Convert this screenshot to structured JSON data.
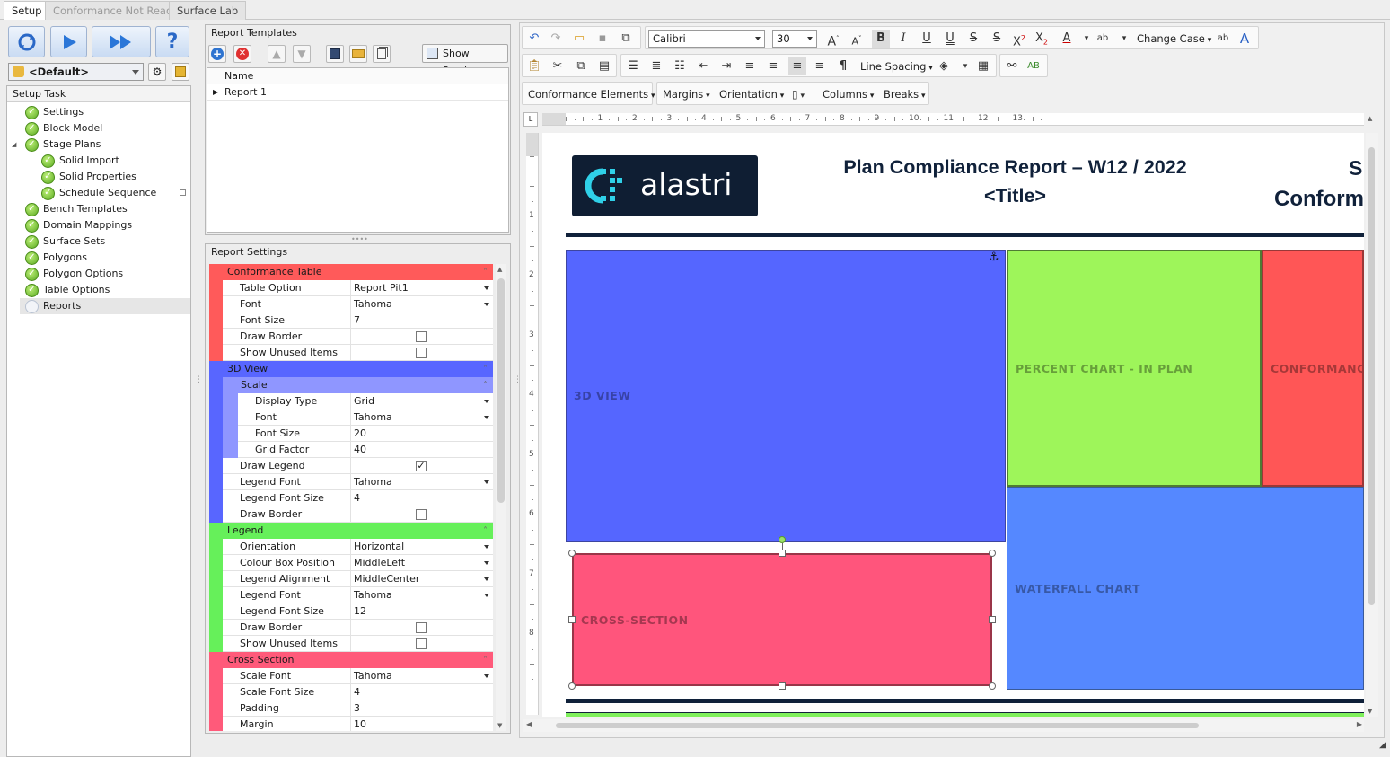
{
  "top_tabs": [
    "Setup",
    "Conformance Not Ready",
    "Surface Lab"
  ],
  "setup": {
    "profile": "<Default>",
    "task_header": "Setup Task",
    "tasks": [
      {
        "label": "Settings",
        "done": true,
        "level": 0
      },
      {
        "label": "Block Model",
        "done": true,
        "level": 0
      },
      {
        "label": "Stage Plans",
        "done": true,
        "level": 0
      },
      {
        "label": "Solid Import",
        "done": true,
        "level": 1
      },
      {
        "label": "Solid Properties",
        "done": true,
        "level": 1
      },
      {
        "label": "Schedule Sequence",
        "done": true,
        "level": 1
      },
      {
        "label": "Bench Templates",
        "done": true,
        "level": 0
      },
      {
        "label": "Domain Mappings",
        "done": true,
        "level": 0
      },
      {
        "label": "Surface Sets",
        "done": true,
        "level": 0
      },
      {
        "label": "Polygons",
        "done": true,
        "level": 0
      },
      {
        "label": "Polygon Options",
        "done": true,
        "level": 0
      },
      {
        "label": "Table Options",
        "done": true,
        "level": 0
      },
      {
        "label": "Reports",
        "done": false,
        "level": 0
      }
    ]
  },
  "report_templates": {
    "title": "Report Templates",
    "show_preview": "Show Preview",
    "column": "Name",
    "rows": [
      "Report 1"
    ]
  },
  "report_settings": {
    "title": "Report Settings",
    "sections": {
      "conformance": {
        "title": "Conformance Table",
        "color": "#ff5a5a",
        "rows": [
          {
            "label": "Table Option",
            "value": "Report Pit1",
            "kind": "dropdown"
          },
          {
            "label": "Font",
            "value": "Tahoma",
            "kind": "dropdown"
          },
          {
            "label": "Font Size",
            "value": "7",
            "kind": "text"
          },
          {
            "label": "Draw Border",
            "value": "",
            "kind": "check",
            "checked": false
          },
          {
            "label": "Show Unused Items",
            "value": "",
            "kind": "check",
            "checked": false
          }
        ]
      },
      "view3d": {
        "title": "3D View",
        "color": "#5866ff",
        "scale_title": "Scale",
        "scale_rows": [
          {
            "label": "Display Type",
            "value": "Grid",
            "kind": "dropdown"
          },
          {
            "label": "Font",
            "value": "Tahoma",
            "kind": "dropdown"
          },
          {
            "label": "Font Size",
            "value": "20",
            "kind": "text"
          },
          {
            "label": "Grid Factor",
            "value": "40",
            "kind": "text"
          }
        ],
        "rows": [
          {
            "label": "Draw Legend",
            "value": "",
            "kind": "check",
            "checked": true
          },
          {
            "label": "Legend Font",
            "value": "Tahoma",
            "kind": "dropdown"
          },
          {
            "label": "Legend Font Size",
            "value": "4",
            "kind": "text"
          },
          {
            "label": "Draw Border",
            "value": "",
            "kind": "check",
            "checked": false
          }
        ]
      },
      "legend": {
        "title": "Legend",
        "color": "#66f05a",
        "rows": [
          {
            "label": "Orientation",
            "value": "Horizontal",
            "kind": "dropdown"
          },
          {
            "label": "Colour Box Position",
            "value": "MiddleLeft",
            "kind": "dropdown"
          },
          {
            "label": "Legend Alignment",
            "value": "MiddleCenter",
            "kind": "dropdown"
          },
          {
            "label": "Legend Font",
            "value": "Tahoma",
            "kind": "dropdown"
          },
          {
            "label": "Legend Font Size",
            "value": "12",
            "kind": "text"
          },
          {
            "label": "Draw Border",
            "value": "",
            "kind": "check",
            "checked": false
          },
          {
            "label": "Show Unused Items",
            "value": "",
            "kind": "check",
            "checked": false
          }
        ]
      },
      "cross": {
        "title": "Cross Section",
        "color": "#ff5a7a",
        "rows": [
          {
            "label": "Scale Font",
            "value": "Tahoma",
            "kind": "dropdown"
          },
          {
            "label": "Scale Font Size",
            "value": "4",
            "kind": "text"
          },
          {
            "label": "Padding",
            "value": "3",
            "kind": "text"
          },
          {
            "label": "Margin",
            "value": "10",
            "kind": "text"
          }
        ]
      }
    }
  },
  "editor": {
    "font_name": "Calibri",
    "font_size": "30",
    "change_case": "Change Case",
    "line_spacing": "Line Spacing",
    "menus": [
      "Conformance Elements",
      "Margins",
      "Orientation",
      "Columns",
      "Breaks"
    ],
    "ruler_numbers": [
      "1",
      "2",
      "3",
      "4",
      "5",
      "6",
      "7",
      "8",
      "9",
      "10",
      "11",
      "12",
      "13"
    ],
    "vruler_numbers": [
      "1",
      "2",
      "3",
      "4",
      "5",
      "6",
      "7",
      "8"
    ]
  },
  "document": {
    "logo_text": "alastri",
    "title_line1": "Plan Compliance Report – W12 / 2022",
    "title_line2": "<Title>",
    "right_line1": "S",
    "right_line2": "Conform",
    "blocks": {
      "view3d": {
        "label": "3D VIEW",
        "color": "#5566ff"
      },
      "percent": {
        "label": "PERCENT CHART - IN PLAN",
        "color": "#9ef55a"
      },
      "conformance": {
        "label": "CONFORMANC",
        "color": "#ff5656"
      },
      "waterfall": {
        "label": "WATERFALL CHART",
        "color": "#5588ff"
      },
      "cross": {
        "label": "CROSS-SECTION",
        "color": "#ff557c"
      }
    }
  }
}
